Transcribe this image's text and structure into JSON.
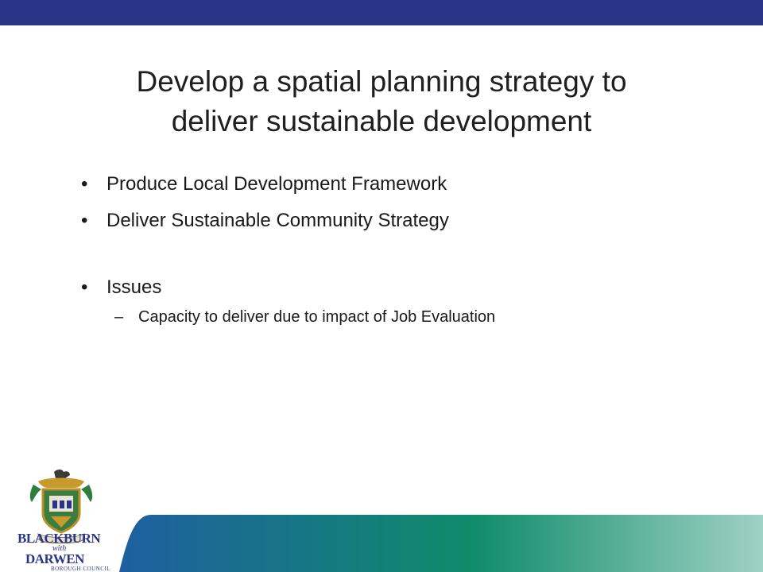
{
  "slide": {
    "title_line1": "Develop a spatial planning strategy to",
    "title_line2": "deliver sustainable development",
    "bullets": [
      "Produce Local Development Framework",
      "Deliver Sustainable Community Strategy",
      "Issues"
    ],
    "sub_bullet": "Capacity to deliver due to impact of Job Evaluation",
    "bullet_glyph": "•",
    "sub_glyph": "–"
  },
  "logo": {
    "line1": "BLACKBURN",
    "with": "with",
    "line2": "DARWEN",
    "line3": "BOROUGH COUNCIL"
  },
  "colors": {
    "top_bar": "#2b3587",
    "band_left": "#1e5fa0",
    "band_mid": "#0f8c6a",
    "band_right": "#9fd1c4"
  }
}
